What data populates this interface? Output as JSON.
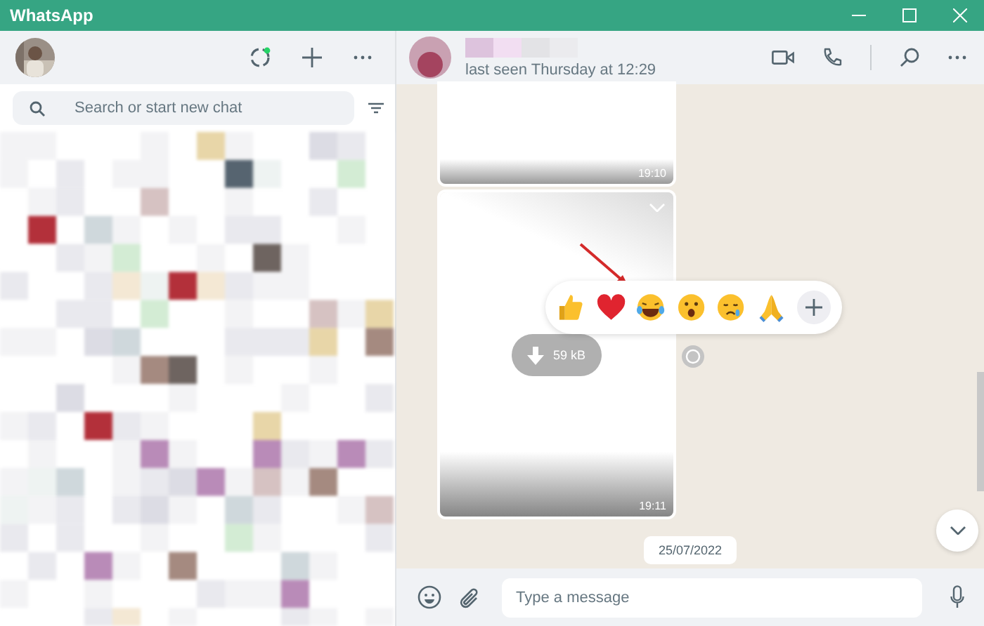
{
  "window": {
    "title": "WhatsApp"
  },
  "sidebar": {
    "search": {
      "placeholder": "Search or start new chat"
    }
  },
  "chat": {
    "header": {
      "status": "last seen Thursday at 12:29"
    },
    "messages": [
      {
        "time": "19:10"
      },
      {
        "kind": "file",
        "time": "19:11",
        "size": "59 kB"
      }
    ],
    "date_chip": "25/07/2022"
  },
  "reactions": [
    {
      "kind": "thumbs-up"
    },
    {
      "kind": "heart"
    },
    {
      "kind": "laughing"
    },
    {
      "kind": "surprised"
    },
    {
      "kind": "crying"
    },
    {
      "kind": "praying"
    }
  ],
  "composer": {
    "placeholder": "Type a message"
  }
}
